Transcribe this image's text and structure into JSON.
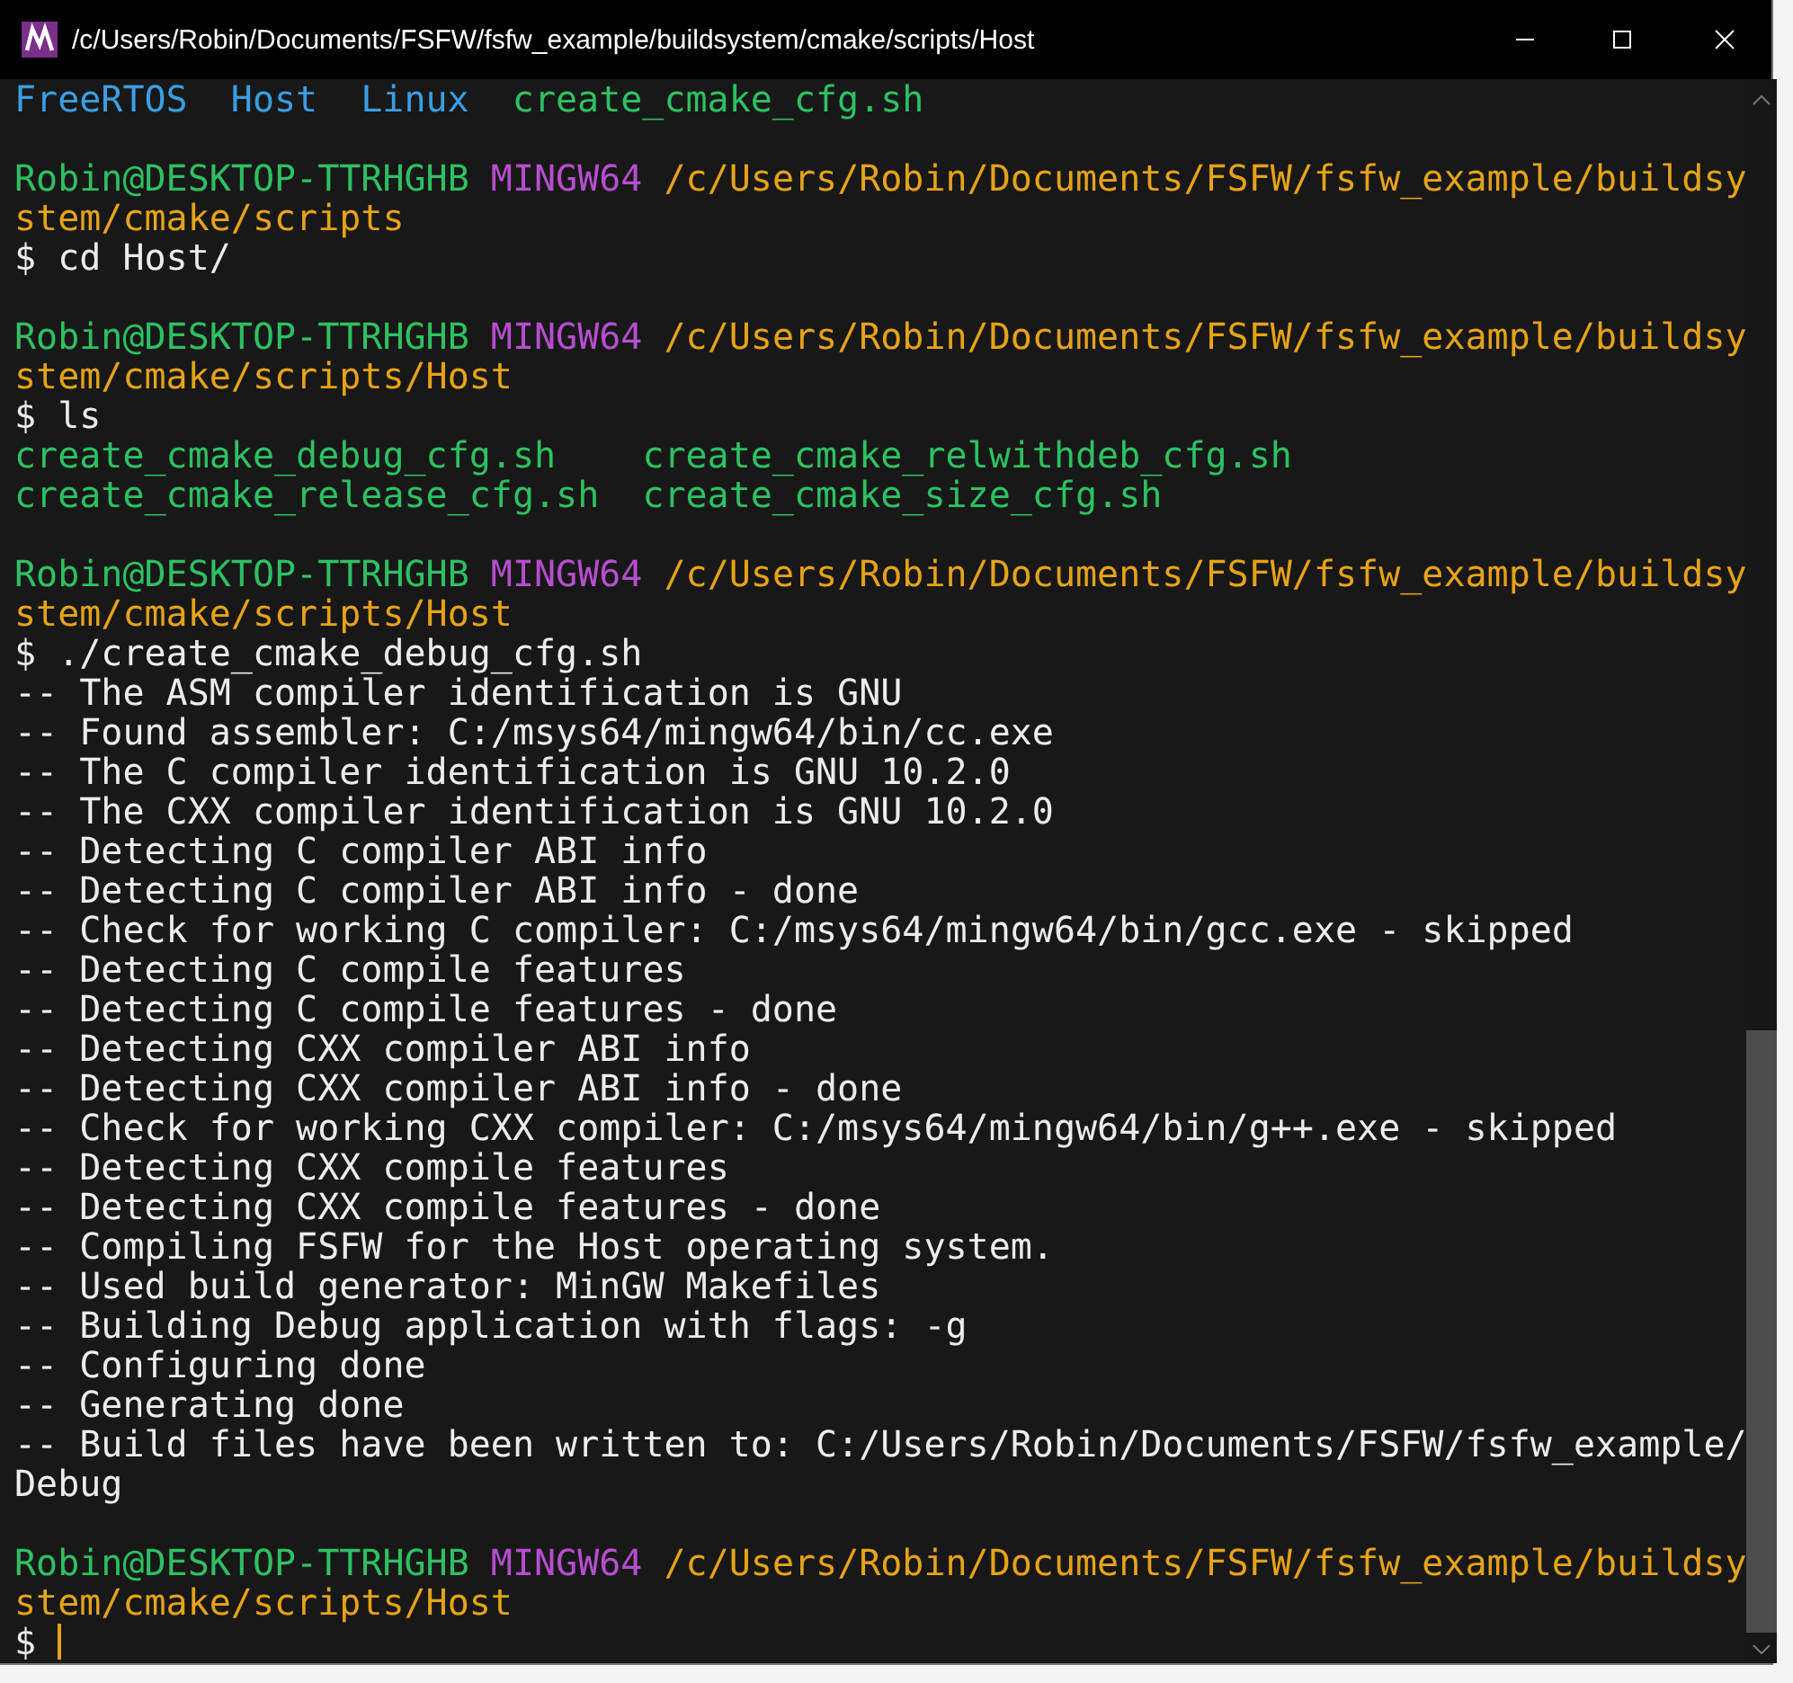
{
  "window": {
    "title": "/c/Users/Robin/Documents/FSFW/fsfw_example/buildsystem/cmake/scripts/Host"
  },
  "blocks": [
    [
      {
        "kind": "listing",
        "rows": [
          [
            {
              "text": "FreeRTOS",
              "kind": "dir"
            },
            {
              "text": "Host",
              "kind": "dir"
            },
            {
              "text": "Linux",
              "kind": "dir"
            },
            {
              "text": "create_cmake_cfg.sh",
              "kind": "file"
            }
          ]
        ]
      }
    ],
    [
      {
        "kind": "text",
        "segments": [
          {
            "text": "Robin@DESKTOP-TTRHGHB",
            "kind": "user"
          },
          {
            "text": "MINGW64",
            "kind": "system"
          },
          {
            "text": "/c/Users/Robin/Documents/FSFW/fsfw_example/buildsy",
            "kind": "path"
          }
        ]
      },
      {
        "kind": "text",
        "segments": [
          {
            "text": "stem/cmake/scripts",
            "kind": "path"
          }
        ]
      },
      {
        "kind": "text",
        "segments": [
          {
            "text": "$ cd Host/",
            "kind": "plain"
          }
        ]
      }
    ],
    [
      {
        "kind": "text",
        "segments": [
          {
            "text": "Robin@DESKTOP-TTRHGHB",
            "kind": "user"
          },
          {
            "text": "MINGW64",
            "kind": "system"
          },
          {
            "text": "/c/Users/Robin/Documents/FSFW/fsfw_example/buildsy",
            "kind": "path"
          }
        ]
      },
      {
        "kind": "text",
        "segments": [
          {
            "text": "stem/cmake/scripts/Host",
            "kind": "path"
          }
        ]
      },
      {
        "kind": "text",
        "segments": [
          {
            "text": "$ ls",
            "kind": "plain"
          }
        ]
      },
      {
        "kind": "listing",
        "rows": [
          [
            {
              "text": "create_cmake_debug_cfg.sh",
              "kind": "file"
            },
            {
              "text": "create_cmake_relwithdeb_cfg.sh",
              "kind": "file"
            }
          ],
          [
            {
              "text": "create_cmake_release_cfg.sh",
              "kind": "file"
            },
            {
              "text": "create_cmake_size_cfg.sh",
              "kind": "file"
            }
          ]
        ]
      }
    ],
    [
      {
        "kind": "text",
        "segments": [
          {
            "text": "Robin@DESKTOP-TTRHGHB",
            "kind": "user"
          },
          {
            "text": "MINGW64",
            "kind": "system"
          },
          {
            "text": "/c/Users/Robin/Documents/FSFW/fsfw_example/buildsy",
            "kind": "path"
          }
        ]
      },
      {
        "kind": "text",
        "segments": [
          {
            "text": "stem/cmake/scripts/Host",
            "kind": "path"
          }
        ]
      },
      {
        "kind": "text",
        "segments": [
          {
            "text": "$ ./create_cmake_debug_cfg.sh",
            "kind": "plain"
          }
        ]
      },
      {
        "kind": "text",
        "segments": [
          {
            "text": "-- The ASM compiler identification is GNU",
            "kind": "plain"
          }
        ]
      },
      {
        "kind": "text",
        "segments": [
          {
            "text": "-- Found assembler: C:/msys64/mingw64/bin/cc.exe",
            "kind": "plain"
          }
        ]
      },
      {
        "kind": "text",
        "segments": [
          {
            "text": "-- The C compiler identification is GNU 10.2.0",
            "kind": "plain"
          }
        ]
      },
      {
        "kind": "text",
        "segments": [
          {
            "text": "-- The CXX compiler identification is GNU 10.2.0",
            "kind": "plain"
          }
        ]
      },
      {
        "kind": "text",
        "segments": [
          {
            "text": "-- Detecting C compiler ABI info",
            "kind": "plain"
          }
        ]
      },
      {
        "kind": "text",
        "segments": [
          {
            "text": "-- Detecting C compiler ABI info - done",
            "kind": "plain"
          }
        ]
      },
      {
        "kind": "text",
        "segments": [
          {
            "text": "-- Check for working C compiler: C:/msys64/mingw64/bin/gcc.exe - skipped",
            "kind": "plain"
          }
        ]
      },
      {
        "kind": "text",
        "segments": [
          {
            "text": "-- Detecting C compile features",
            "kind": "plain"
          }
        ]
      },
      {
        "kind": "text",
        "segments": [
          {
            "text": "-- Detecting C compile features - done",
            "kind": "plain"
          }
        ]
      },
      {
        "kind": "text",
        "segments": [
          {
            "text": "-- Detecting CXX compiler ABI info",
            "kind": "plain"
          }
        ]
      },
      {
        "kind": "text",
        "segments": [
          {
            "text": "-- Detecting CXX compiler ABI info - done",
            "kind": "plain"
          }
        ]
      },
      {
        "kind": "text",
        "segments": [
          {
            "text": "-- Check for working CXX compiler: C:/msys64/mingw64/bin/g++.exe - skipped",
            "kind": "plain"
          }
        ]
      },
      {
        "kind": "text",
        "segments": [
          {
            "text": "-- Detecting CXX compile features",
            "kind": "plain"
          }
        ]
      },
      {
        "kind": "text",
        "segments": [
          {
            "text": "-- Detecting CXX compile features - done",
            "kind": "plain"
          }
        ]
      },
      {
        "kind": "text",
        "segments": [
          {
            "text": "-- Compiling FSFW for the Host operating system.",
            "kind": "plain"
          }
        ]
      },
      {
        "kind": "text",
        "segments": [
          {
            "text": "-- Used build generator: MinGW Makefiles",
            "kind": "plain"
          }
        ]
      },
      {
        "kind": "text",
        "segments": [
          {
            "text": "-- Building Debug application with flags: -g",
            "kind": "plain"
          }
        ]
      },
      {
        "kind": "text",
        "segments": [
          {
            "text": "-- Configuring done",
            "kind": "plain"
          }
        ]
      },
      {
        "kind": "text",
        "segments": [
          {
            "text": "-- Generating done",
            "kind": "plain"
          }
        ]
      },
      {
        "kind": "text",
        "segments": [
          {
            "text": "-- Build files have been written to: C:/Users/Robin/Documents/FSFW/fsfw_example/",
            "kind": "plain"
          }
        ]
      },
      {
        "kind": "text",
        "segments": [
          {
            "text": "Debug",
            "kind": "plain"
          }
        ]
      }
    ],
    [
      {
        "kind": "text",
        "segments": [
          {
            "text": "Robin@DESKTOP-TTRHGHB",
            "kind": "user"
          },
          {
            "text": "MINGW64",
            "kind": "system"
          },
          {
            "text": "/c/Users/Robin/Documents/FSFW/fsfw_example/buildsy",
            "kind": "path"
          }
        ]
      },
      {
        "kind": "text",
        "segments": [
          {
            "text": "stem/cmake/scripts/Host",
            "kind": "path"
          }
        ]
      },
      {
        "kind": "text",
        "cursor": true,
        "segments": [
          {
            "text": "$",
            "kind": "plain"
          }
        ]
      }
    ]
  ]
}
